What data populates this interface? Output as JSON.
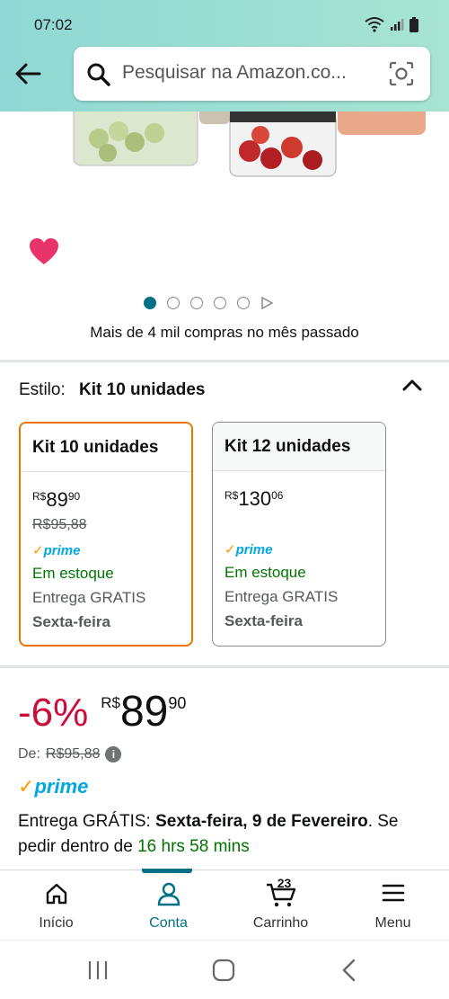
{
  "status": {
    "time": "07:02"
  },
  "search": {
    "placeholder": "Pesquisar na Amazon.co..."
  },
  "product": {
    "monthly_purchases": "Mais de 4 mil compras no mês passado",
    "style_label": "Estilo:",
    "style_value": "Kit 10 unidades",
    "options": [
      {
        "title": "Kit 10 unidades",
        "currency": "R$",
        "price_int": "89",
        "price_frac": "90",
        "list_price": "R$95,88",
        "prime": "prime",
        "stock": "Em estoque",
        "delivery": "Entrega GRATIS",
        "day": "Sexta-feira"
      },
      {
        "title": "Kit 12 unidades",
        "currency": "R$",
        "price_int": "130",
        "price_frac": "06",
        "list_price": "",
        "prime": "prime",
        "stock": "Em estoque",
        "delivery": "Entrega GRATIS",
        "day": "Sexta-feira"
      }
    ],
    "discount": "-6%",
    "currency": "R$",
    "price_int": "89",
    "price_frac": "90",
    "from_label": "De:",
    "from_price": "R$95,88",
    "prime": "prime",
    "delivery_prefix": "Entrega GRÁTIS: ",
    "delivery_date": "Sexta-feira, 9 de Fevereiro",
    "delivery_mid": ". Se pedir dentro de ",
    "delivery_time": "16 hrs 58 mins"
  },
  "tabs": [
    {
      "label": "Início",
      "icon": "home-icon"
    },
    {
      "label": "Conta",
      "icon": "account-icon"
    },
    {
      "label": "Carrinho",
      "icon": "cart-icon",
      "count": "23"
    },
    {
      "label": "Menu",
      "icon": "menu-icon"
    }
  ],
  "colors": {
    "accent": "#007185",
    "discount": "#cc0c39",
    "selected_border": "#e77600",
    "stock": "#007600",
    "heart": "#e8336b"
  }
}
